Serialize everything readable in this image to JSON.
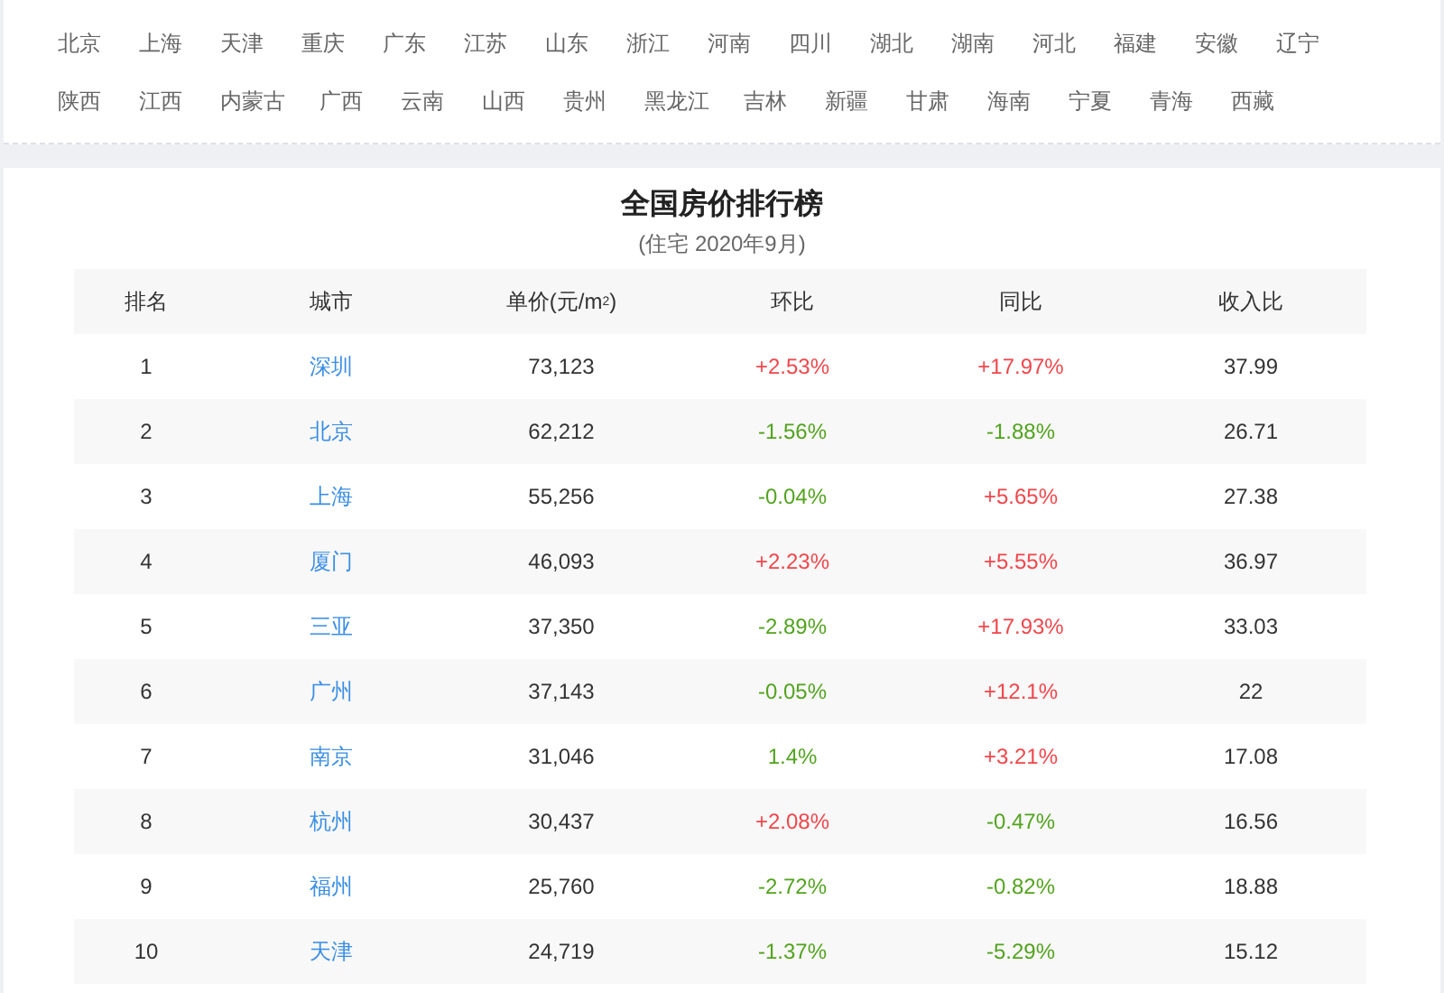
{
  "regions": [
    [
      "北京",
      "上海",
      "天津",
      "重庆",
      "广东",
      "江苏",
      "山东",
      "浙江",
      "河南",
      "四川",
      "湖北",
      "湖南",
      "河北",
      "福建",
      "安徽",
      "辽宁"
    ],
    [
      "陕西",
      "江西",
      "内蒙古",
      "广西",
      "云南",
      "山西",
      "贵州",
      "黑龙江",
      "吉林",
      "新疆",
      "甘肃",
      "海南",
      "宁夏",
      "青海",
      "西藏"
    ]
  ],
  "ranking": {
    "title": "全国房价排行榜",
    "subtitle": "(住宅 2020年9月)",
    "columns": [
      "排名",
      "城市",
      "单价(元/m$^{2}$)",
      "环比",
      "同比",
      "收入比"
    ],
    "rows": [
      {
        "rank": "1",
        "city": "深圳",
        "price": "73,123",
        "mom": {
          "text": "+2.53%",
          "color": "#f0464b"
        },
        "yoy": {
          "text": "+17.97%",
          "color": "#f0464b"
        },
        "ratio": "37.99"
      },
      {
        "rank": "2",
        "city": "北京",
        "price": "62,212",
        "mom": {
          "text": "-1.56%",
          "color": "#52a31e"
        },
        "yoy": {
          "text": "-1.88%",
          "color": "#52a31e"
        },
        "ratio": "26.71"
      },
      {
        "rank": "3",
        "city": "上海",
        "price": "55,256",
        "mom": {
          "text": "-0.04%",
          "color": "#52a31e"
        },
        "yoy": {
          "text": "+5.65%",
          "color": "#f0464b"
        },
        "ratio": "27.38"
      },
      {
        "rank": "4",
        "city": "厦门",
        "price": "46,093",
        "mom": {
          "text": "+2.23%",
          "color": "#f0464b"
        },
        "yoy": {
          "text": "+5.55%",
          "color": "#f0464b"
        },
        "ratio": "36.97"
      },
      {
        "rank": "5",
        "city": "三亚",
        "price": "37,350",
        "mom": {
          "text": "-2.89%",
          "color": "#52a31e"
        },
        "yoy": {
          "text": "+17.93%",
          "color": "#f0464b"
        },
        "ratio": "33.03"
      },
      {
        "rank": "6",
        "city": "广州",
        "price": "37,143",
        "mom": {
          "text": "-0.05%",
          "color": "#52a31e"
        },
        "yoy": {
          "text": "+12.1%",
          "color": "#f0464b"
        },
        "ratio": "22"
      },
      {
        "rank": "7",
        "city": "南京",
        "price": "31,046",
        "mom": {
          "text": "1.4%",
          "color": "#52a31e"
        },
        "yoy": {
          "text": "+3.21%",
          "color": "#f0464b"
        },
        "ratio": "17.08"
      },
      {
        "rank": "8",
        "city": "杭州",
        "price": "30,437",
        "mom": {
          "text": "+2.08%",
          "color": "#f0464b"
        },
        "yoy": {
          "text": "-0.47%",
          "color": "#52a31e"
        },
        "ratio": "16.56"
      },
      {
        "rank": "9",
        "city": "福州",
        "price": "25,760",
        "mom": {
          "text": "-2.72%",
          "color": "#52a31e"
        },
        "yoy": {
          "text": "-0.82%",
          "color": "#52a31e"
        },
        "ratio": "18.88"
      },
      {
        "rank": "10",
        "city": "天津",
        "price": "24,719",
        "mom": {
          "text": "-1.37%",
          "color": "#52a31e"
        },
        "yoy": {
          "text": "-5.29%",
          "color": "#52a31e"
        },
        "ratio": "15.12"
      }
    ]
  }
}
